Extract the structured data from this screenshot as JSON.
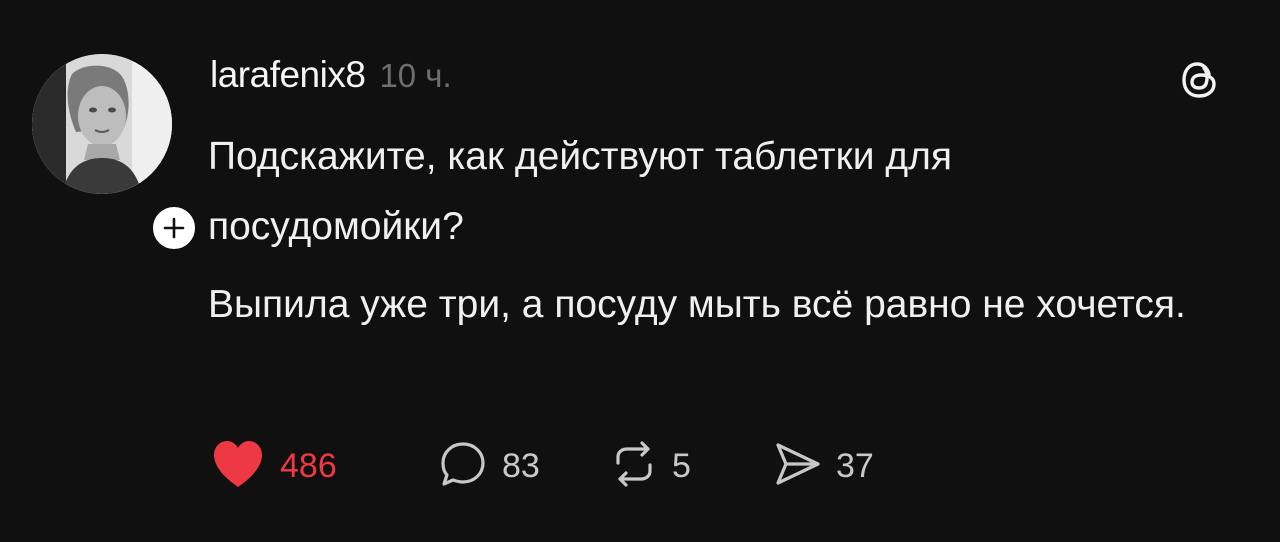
{
  "post": {
    "username": "larafenix8",
    "time": "10 ч.",
    "paragraphs": [
      "Подскажите, как действуют таблетки для посудомойки?",
      "Выпила уже три, а посуду мыть всё равно не хочется."
    ],
    "actions": {
      "likes": "486",
      "replies": "83",
      "reposts": "5",
      "shares": "37"
    },
    "liked": true
  },
  "icons": {
    "like": "heart-filled-icon",
    "reply": "speech-bubble-icon",
    "repost": "repost-arrows-icon",
    "share": "send-arrow-icon",
    "follow": "plus-icon",
    "logo": "threads-logo-icon"
  },
  "colors": {
    "background": "#101010",
    "text": "#f0f0f0",
    "muted": "#6e6e6e",
    "like": "#ee3844"
  }
}
